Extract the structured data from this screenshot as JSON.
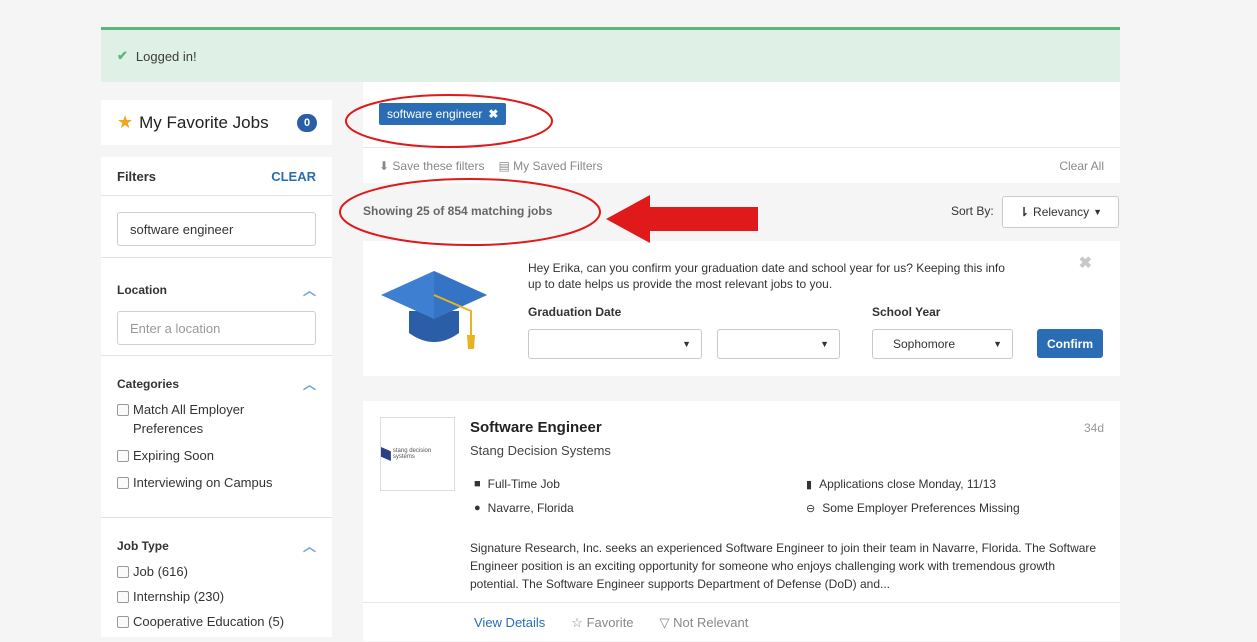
{
  "alert": {
    "text": "Logged in!"
  },
  "favorites": {
    "label": "My Favorite Jobs",
    "count": "0"
  },
  "filters": {
    "title": "Filters",
    "clear": "CLEAR",
    "keyword": "software engineer",
    "location": {
      "title": "Location",
      "placeholder": "Enter a location"
    },
    "categories": {
      "title": "Categories",
      "items": [
        "Match All Employer Preferences",
        "Expiring Soon",
        "Interviewing on Campus"
      ]
    },
    "job_type": {
      "title": "Job Type",
      "items": [
        "Job (616)",
        "Internship (230)",
        "Cooperative Education (5)"
      ]
    }
  },
  "search": {
    "tag": "software engineer",
    "save_filters": "Save these filters",
    "saved_filters": "My Saved Filters",
    "clear_all": "Clear All"
  },
  "results": {
    "showing": "Showing 25 of 854 matching jobs",
    "sort_label": "Sort By:",
    "sort_value": "Relevancy"
  },
  "grad_prompt": {
    "message": "Hey Erika, can you confirm your graduation date and school year for us? Keeping this info up to date helps us provide the most relevant jobs to you.",
    "graduation_label": "Graduation Date",
    "school_year_label": "School Year",
    "school_year_value": "Sophomore",
    "confirm": "Confirm"
  },
  "job": {
    "title": "Software Engineer",
    "company": "Stang Decision Systems",
    "age": "34d",
    "type": "Full-Time Job",
    "location": "Navarre, Florida",
    "deadline": "Applications close Monday, 11/13",
    "preferences": "Some Employer Preferences Missing",
    "description": "Signature Research, Inc. seeks an experienced Software Engineer to join their team in Navarre, Florida. The Software Engineer position is an exciting opportunity for someone who enjoys challenging work with tremendous growth potential. The Software Engineer supports Department of Defense (DoD) and...",
    "view_details": "View Details",
    "favorite": "Favorite",
    "not_relevant": "Not Relevant",
    "logo_text": "stang decision systems"
  },
  "colors": {
    "accent": "#2a6db5",
    "alert_bg": "#dff0e6",
    "annotation": "#e0191b"
  }
}
